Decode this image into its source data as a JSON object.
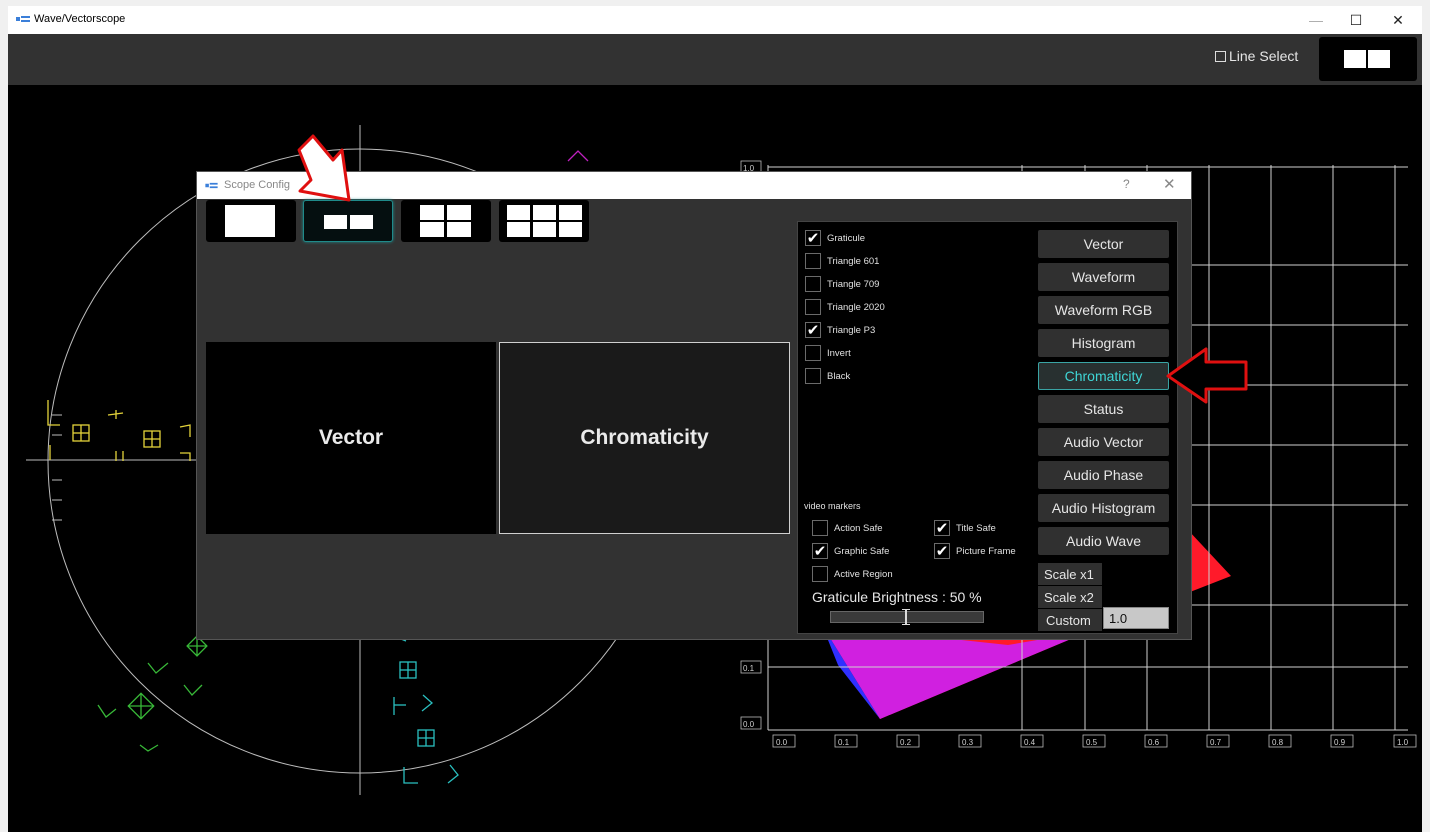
{
  "window": {
    "title": "Wave/Vectorscope",
    "minimize_icon": "—",
    "maximize_icon": "☐",
    "close_icon": "✕"
  },
  "toolbar": {
    "line_select_label": "Line Select",
    "line_select_checked": false
  },
  "chromaticity_plot": {
    "y_ticks": [
      "1.0",
      "0.1",
      "0.0"
    ],
    "x_ticks": [
      "0.0",
      "0.1",
      "0.2",
      "0.3",
      "0.4",
      "0.5",
      "0.6",
      "0.7",
      "0.8",
      "0.9",
      "1.0"
    ]
  },
  "dialog": {
    "title": "Scope Config",
    "help_icon": "?",
    "close_icon": "✕",
    "layouts": [
      "single",
      "dual",
      "quad",
      "six"
    ],
    "selected_layout": "dual",
    "preview_panels": [
      "Vector",
      "Chromaticity"
    ],
    "selected_panel": "Chromaticity",
    "options": [
      {
        "label": "Graticule",
        "checked": true
      },
      {
        "label": "Triangle 601",
        "checked": false
      },
      {
        "label": "Triangle 709",
        "checked": false
      },
      {
        "label": "Triangle 2020",
        "checked": false
      },
      {
        "label": "Triangle P3",
        "checked": true
      },
      {
        "label": "Invert",
        "checked": false
      },
      {
        "label": "Black",
        "checked": false
      }
    ],
    "video_markers_label": "video markers",
    "markers": [
      {
        "label": "Action Safe",
        "checked": false
      },
      {
        "label": "Title Safe",
        "checked": true
      },
      {
        "label": "Graphic Safe",
        "checked": true
      },
      {
        "label": "Picture Frame",
        "checked": true
      },
      {
        "label": "Active Region",
        "checked": false
      }
    ],
    "brightness_label": "Graticule Brightness : 50 %",
    "brightness_value": 50,
    "scope_types": [
      "Vector",
      "Waveform",
      "Waveform RGB",
      "Histogram",
      "Chromaticity",
      "Status",
      "Audio Vector",
      "Audio Phase",
      "Audio Histogram",
      "Audio Wave"
    ],
    "selected_scope": "Chromaticity",
    "scale_x1": "Scale x1",
    "scale_x2": "Scale x2",
    "custom_label": "Custom",
    "custom_value": "1.0"
  },
  "colors": {
    "accent": "#3fd6d6",
    "annotation_arrow": "#e01010",
    "toolbar": "#323232",
    "dialog": "#323232"
  }
}
